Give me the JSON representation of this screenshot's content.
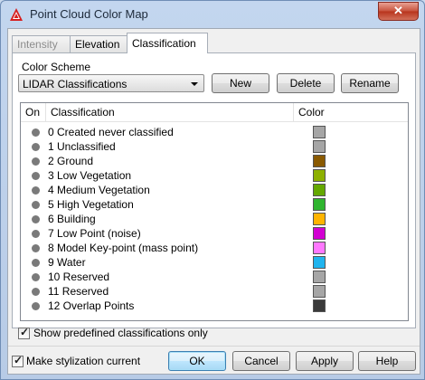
{
  "window": {
    "title": "Point Cloud Color Map",
    "close_label": "✕"
  },
  "tabs": [
    {
      "label": "Intensity",
      "state": "disabled"
    },
    {
      "label": "Elevation",
      "state": "normal"
    },
    {
      "label": "Classification",
      "state": "active"
    }
  ],
  "color_scheme": {
    "label": "Color Scheme",
    "selected": "LIDAR Classifications",
    "new_label": "New",
    "delete_label": "Delete",
    "rename_label": "Rename"
  },
  "list": {
    "columns": {
      "on": "On",
      "classification": "Classification",
      "color": "Color"
    },
    "rows": [
      {
        "label": "0 Created never classified",
        "color": "#a6a6a6"
      },
      {
        "label": "1 Unclassified",
        "color": "#a6a6a6"
      },
      {
        "label": "2 Ground",
        "color": "#8a5a00"
      },
      {
        "label": "3 Low Vegetation",
        "color": "#8db000"
      },
      {
        "label": "4 Medium Vegetation",
        "color": "#64a800"
      },
      {
        "label": "5 High Vegetation",
        "color": "#2fb52f"
      },
      {
        "label": "6 Building",
        "color": "#ffb400"
      },
      {
        "label": "7 Low Point (noise)",
        "color": "#d200d2"
      },
      {
        "label": "8 Model Key-point (mass point)",
        "color": "#ff78ff"
      },
      {
        "label": "9 Water",
        "color": "#20b4ee"
      },
      {
        "label": "10 Reserved",
        "color": "#a6a6a6"
      },
      {
        "label": "11 Reserved",
        "color": "#a6a6a6"
      },
      {
        "label": "12 Overlap Points",
        "color": "#3a3a3a"
      }
    ]
  },
  "show_predefined": {
    "label": "Show predefined classifications only",
    "checked": true
  },
  "footer": {
    "make_current_label": "Make stylization current",
    "make_current_checked": true,
    "ok_label": "OK",
    "cancel_label": "Cancel",
    "apply_label": "Apply",
    "help_label": "Help"
  }
}
